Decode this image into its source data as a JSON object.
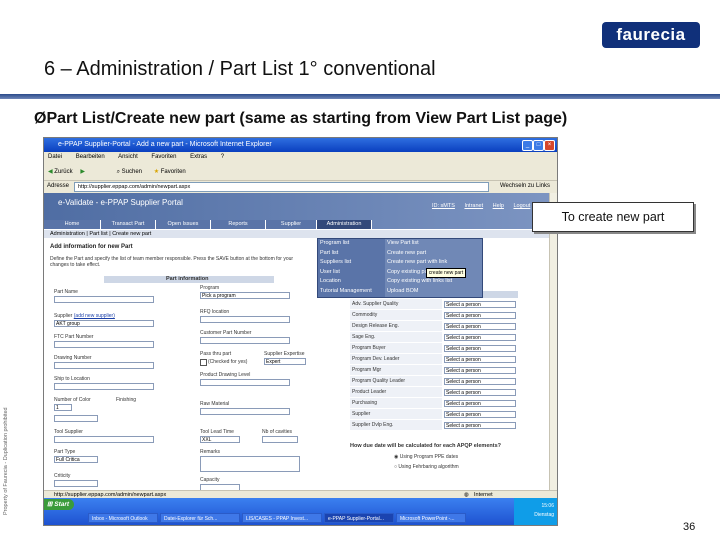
{
  "brand": {
    "logo_text": "faurecia",
    "logo_color": "#10307a"
  },
  "slide": {
    "title": "6 – Administration / Part List 1° conventional",
    "bullet": "Part List/Create new part (same as starting from View Part List page)",
    "side_text": "Property of Faurecia - Duplication prohibited",
    "page_number": "36",
    "callout": "To create new part"
  },
  "window": {
    "title": "e-PPAP Supplier-Portal - Add a new part - Microsoft Internet Explorer",
    "menu": [
      "Datei",
      "Bearbeiten",
      "Ansicht",
      "Favoriten",
      "Extras",
      "?"
    ],
    "toolbar": {
      "back": "Zurück",
      "search": "Suchen",
      "favorites": "Favoriten"
    },
    "address_label": "Adresse",
    "address": "http://supplier.eppap.com/admin/newpart.aspx",
    "go_label": "Wechseln zu",
    "links_label": "Links"
  },
  "portal": {
    "title": "e-Validate - e-PPAP Supplier Portal",
    "top_links": [
      "ID: sMTS",
      "Intranet",
      "Help",
      "Logout"
    ],
    "nav_tabs": [
      "Home",
      "Transact Part",
      "Open Issues",
      "Reports",
      "Supplier",
      "Administration"
    ],
    "subnav": [
      "Administration",
      "Part list",
      "Create new part"
    ],
    "dropdown_menu": [
      "Program list",
      "Part list",
      "Suppliers list",
      "User list",
      "Location",
      "Tutorial Management"
    ],
    "dropdown_submenu": [
      "View Part list",
      "Create new part",
      "Create new part with link",
      "Copy existing part",
      "Copy existing with links list",
      "Upload BOM"
    ],
    "tooltip": "create new part",
    "section_title": "Add information for new Part",
    "description": "Define the Part and specify the list of team member responsible. Press the SAVE button at the bottom for your changes to take effect.",
    "part_info_header": "Part information",
    "fields": {
      "part_name": "Part Name",
      "supplier": "Supplier",
      "supplier_link": "(add new supplier)",
      "supplier_value": "AKT group",
      "ftc_part_number": "FTC Part Number",
      "drawing_number": "Drawing Number",
      "ship_to_location": "Ship to Location",
      "number_of_color": "Number of Color",
      "number_of_color_value": "1",
      "finishing": "Finishing",
      "tool_supplier": "Tool Supplier",
      "part_type": "Part Type",
      "part_type_value": "Full Critica",
      "criticity": "Criticity",
      "program": "Program",
      "program_value": "Pick a program",
      "rfq_location": "RFQ location",
      "customer_part_number": "Customer Part Number",
      "pass_thru_part": "Pass thru part",
      "pass_thru_checkbox": "(Checked for yes)",
      "supplier_expertise": "Supplier Expertise",
      "supplier_expertise_value": "Expert",
      "product_drawing_level": "Product Drawing Level",
      "raw_material": "Raw Material",
      "tool_lead_time": "Tool Lead Time",
      "tool_lead_time_value": "XXL",
      "nb_of_cavities": "Nb of cavities",
      "remarks": "Remarks",
      "capacity": "Capacity"
    },
    "roles_header": "Position",
    "roles": [
      "Adv. Supplier Quality",
      "Commodity",
      "Design Release Eng.",
      "Sage Eng.",
      "Program Buyer",
      "Program Dev. Leader",
      "Program Mgr",
      "Program Quality Leader",
      "Product Leader",
      "Purchasing",
      "Supplier",
      "Supplier Dvlp Eng."
    ],
    "role_select_value": "Select a person",
    "question": "How due date will be calculated for each APQP elements?",
    "radio_options": [
      "Using Program PPE dates",
      "Using Fehrbaring algorithm"
    ]
  },
  "status_bar": {
    "url": "http://supplier.eppap.com/admin/newpart.aspx",
    "zone": "Internet"
  },
  "taskbar": {
    "start": "Start",
    "items": [
      "Inbox - Microsoft Outlook",
      "Datei-Explorer für Sch...",
      "LIS/CASES - PPAP Invest...",
      "e-PPAP Supplier-Portal...",
      "Microsoft PowerPoint -..."
    ],
    "clock": "15:06",
    "day": "Dienstag"
  }
}
